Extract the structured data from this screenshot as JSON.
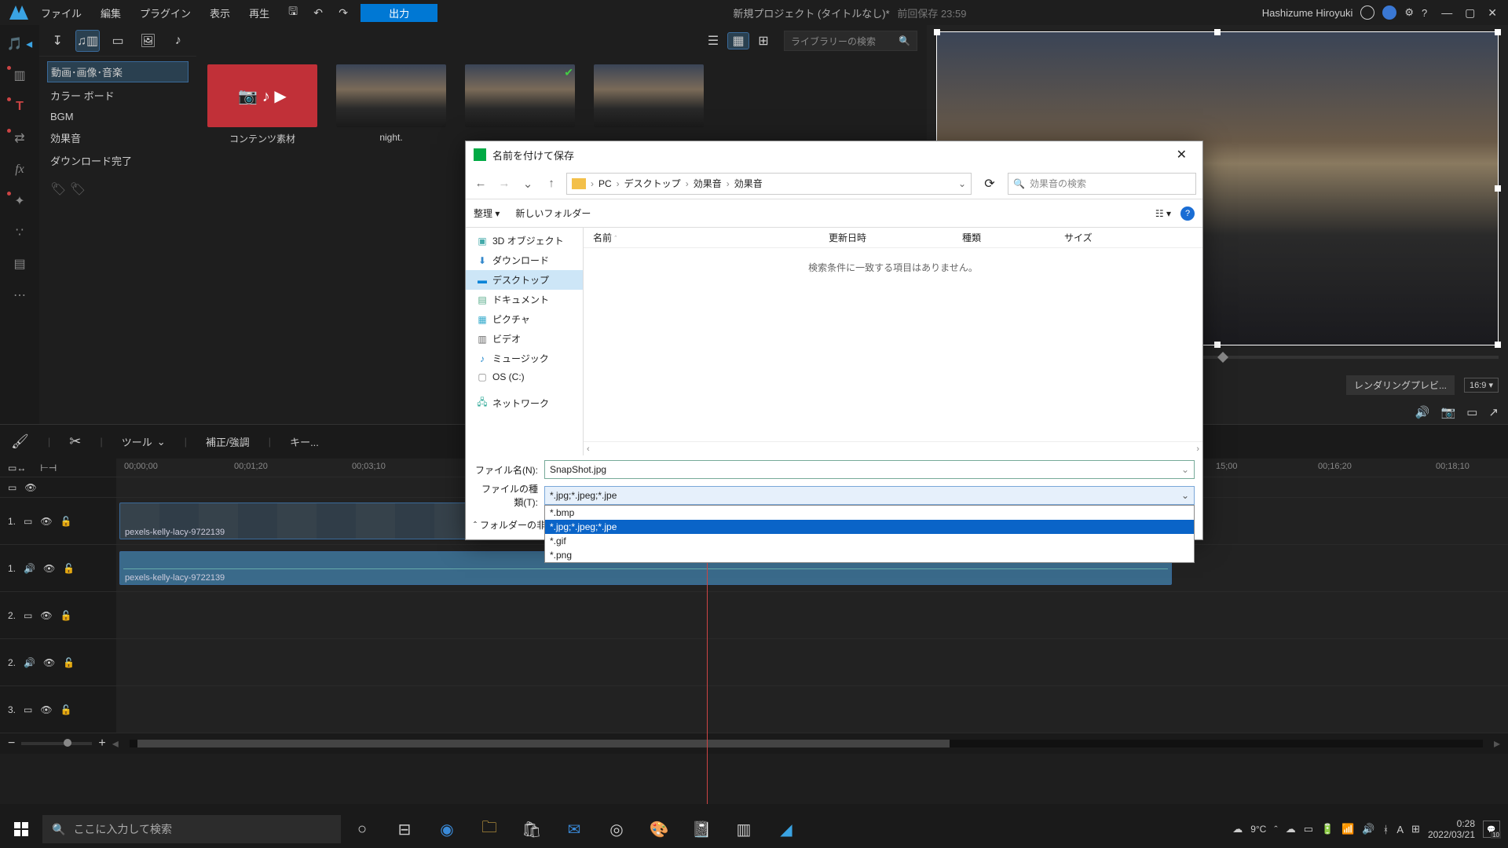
{
  "menubar": {
    "items": [
      "ファイル",
      "編集",
      "プラグイン",
      "表示",
      "再生"
    ],
    "export": "出力",
    "project_title": "新規プロジェクト (タイトルなし)*",
    "last_save_label": "前回保存",
    "last_save_time": "23:59",
    "user": "Hashizume Hiroyuki"
  },
  "rooms": {
    "categories": [
      "動画･画像･音楽",
      "カラー ボード",
      "BGM",
      "効果音",
      "ダウンロード完了"
    ],
    "selected": 0
  },
  "library": {
    "search_placeholder": "ライブラリーの検索",
    "items": [
      {
        "label": "コンテンツ素材",
        "kind": "red"
      },
      {
        "label": "night.",
        "kind": "sky"
      },
      {
        "label": "",
        "kind": "sky",
        "checked": true
      },
      {
        "label": "",
        "kind": "sky"
      }
    ]
  },
  "preview": {
    "render_label": "レンダリングプレビ...",
    "aspect": "16:9"
  },
  "timeline_toolbar": {
    "tool": "ツール",
    "adjust": "補正/強調",
    "keyframe": "キー..."
  },
  "ruler": [
    "00;00;00",
    "00;01;20",
    "00;03;10",
    "",
    "",
    "15;00",
    "00;16;20",
    "00;18;10"
  ],
  "tracks": {
    "video": {
      "label": "1.",
      "clip": "pexels-kelly-lacy-9722139"
    },
    "audio": {
      "label": "1.",
      "clip": "pexels-kelly-lacy-9722139"
    },
    "v2": "2.",
    "a2": "2.",
    "v3": "3."
  },
  "dialog": {
    "title": "名前を付けて保存",
    "breadcrumb": [
      "PC",
      "デスクトップ",
      "効果音",
      "効果音"
    ],
    "search_placeholder": "効果音の検索",
    "organize": "整理",
    "new_folder": "新しいフォルダー",
    "tree": [
      "3D オブジェクト",
      "ダウンロード",
      "デスクトップ",
      "ドキュメント",
      "ピクチャ",
      "ビデオ",
      "ミュージック",
      "OS (C:)",
      "ネットワーク"
    ],
    "tree_selected": 2,
    "cols": {
      "name": "名前",
      "date": "更新日時",
      "type": "種類",
      "size": "サイズ"
    },
    "empty": "検索条件に一致する項目はありません。",
    "filename_label": "ファイル名(N):",
    "filename_value": "SnapShot.jpg",
    "filetype_label": "ファイルの種類(T):",
    "filetype_value": "*.jpg;*.jpeg;*.jpe",
    "filetype_options": [
      "*.bmp",
      "*.jpg;*.jpeg;*.jpe",
      "*.gif",
      "*.png"
    ],
    "filetype_selected": 1,
    "hide_folders": "フォルダーの非表示"
  },
  "taskbar": {
    "search": "ここに入力して検索",
    "weather": "9°C",
    "time": "0:28",
    "date": "2022/03/21",
    "notif_count": "10"
  }
}
